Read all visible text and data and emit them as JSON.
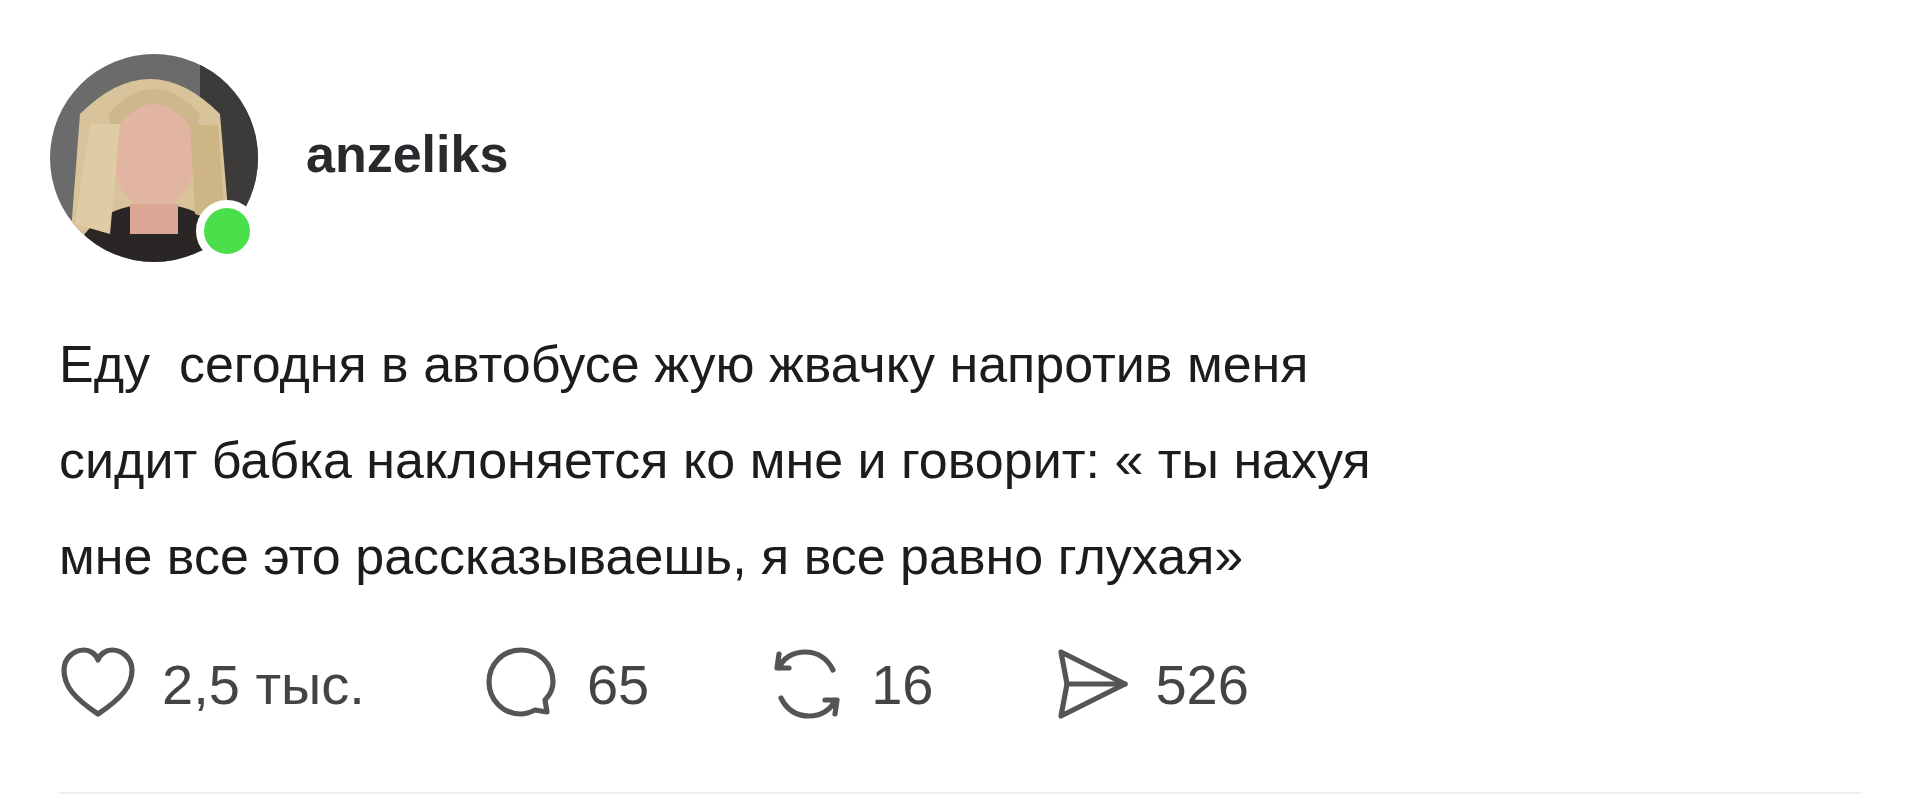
{
  "author": {
    "username": "anzeliks",
    "online": true
  },
  "post": {
    "text": "Еду  сегодня в автобусе жую жвачку напротив меня\nсидит бабка наклоняется ко мне и говорит: « ты нахуя\nмне все это рассказываешь, я все равно глухая»"
  },
  "actions": [
    {
      "kind": "like",
      "count": "2,5 тыс."
    },
    {
      "kind": "comment",
      "count": "65"
    },
    {
      "kind": "repost",
      "count": "16"
    },
    {
      "kind": "share",
      "count": "526"
    }
  ]
}
